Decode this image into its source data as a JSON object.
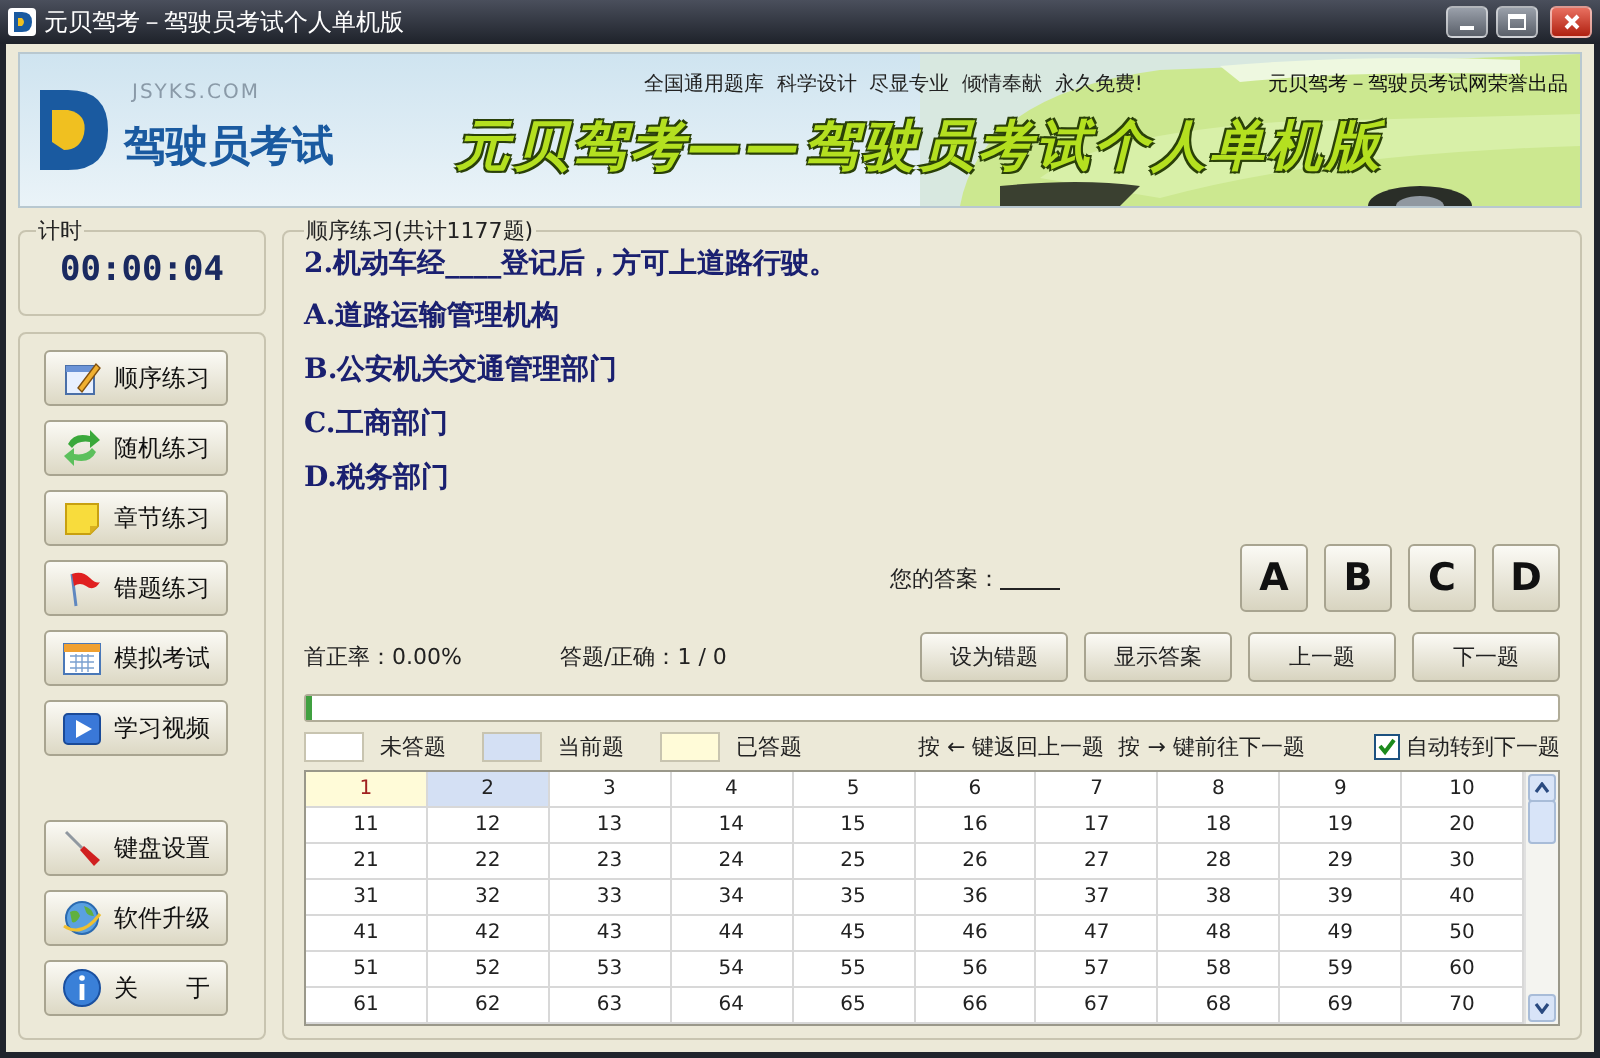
{
  "window": {
    "title": "元贝驾考－驾驶员考试个人单机版"
  },
  "banner": {
    "site": "JSYKS.COM",
    "brand": "驾驶员考试",
    "slogan": "全国通用题库  科学设计  尽显专业  倾情奉献  永久免费!",
    "credit": "元贝驾考－驾驶员考试网荣誉出品",
    "headline": "元贝驾考——驾驶员考试个人单机版"
  },
  "timer": {
    "label": "计时",
    "value": "00:00:04"
  },
  "nav_buttons": [
    "顺序练习",
    "随机练习",
    "章节练习",
    "错题练习",
    "模拟考试",
    "学习视频"
  ],
  "tool_buttons": [
    "键盘设置",
    "软件升级",
    "关　　于"
  ],
  "question": {
    "group_title": "顺序练习(共计1177题)",
    "text": "2.机动车经____登记后，方可上道路行驶。",
    "options": [
      "A.道路运输管理机构",
      "B.公安机关交通管理部门",
      "C.工商部门",
      "D.税务部门"
    ]
  },
  "answer": {
    "label": "您的答案："
  },
  "choice_buttons": [
    "A",
    "B",
    "C",
    "D"
  ],
  "stats": {
    "first_rate": "首正率：0.00%",
    "answered": "答题/正确：1 / 0"
  },
  "action_buttons": [
    "设为错题",
    "显示答案",
    "上一题",
    "下一题"
  ],
  "progress": {
    "level": 0.005
  },
  "legend": [
    {
      "label": "未答题",
      "color": "#ffffff"
    },
    {
      "label": "当前题",
      "color": "#d4e0f4"
    },
    {
      "label": "已答题",
      "color": "#fffbd8"
    }
  ],
  "hint": "按 ← 键返回上一题  按 → 键前往下一题",
  "auto_next": {
    "label": "自动转到下一题",
    "checked": true
  },
  "grid": {
    "cells": [
      {
        "text": "1",
        "color": "#fffbd8",
        "answered": true
      },
      {
        "text": "2",
        "color": "#d4e0f4",
        "answered": false
      },
      {
        "text": "3",
        "color": "#ffffff",
        "answered": false
      },
      {
        "text": "4",
        "color": "#ffffff",
        "answered": false
      },
      {
        "text": "5",
        "color": "#ffffff",
        "answered": false
      },
      {
        "text": "6",
        "color": "#ffffff",
        "answered": false
      },
      {
        "text": "7",
        "color": "#ffffff",
        "answered": false
      },
      {
        "text": "8",
        "color": "#ffffff",
        "answered": false
      },
      {
        "text": "9",
        "color": "#ffffff",
        "answered": false
      },
      {
        "text": "10",
        "color": "#ffffff",
        "answered": false
      },
      {
        "text": "11",
        "color": "#ffffff",
        "answered": false
      },
      {
        "text": "12",
        "color": "#ffffff",
        "answered": false
      },
      {
        "text": "13",
        "color": "#ffffff",
        "answered": false
      },
      {
        "text": "14",
        "color": "#ffffff",
        "answered": false
      },
      {
        "text": "15",
        "color": "#ffffff",
        "answered": false
      },
      {
        "text": "16",
        "color": "#ffffff",
        "answered": false
      },
      {
        "text": "17",
        "color": "#ffffff",
        "answered": false
      },
      {
        "text": "18",
        "color": "#ffffff",
        "answered": false
      },
      {
        "text": "19",
        "color": "#ffffff",
        "answered": false
      },
      {
        "text": "20",
        "color": "#ffffff",
        "answered": false
      },
      {
        "text": "21",
        "color": "#ffffff",
        "answered": false
      },
      {
        "text": "22",
        "color": "#ffffff",
        "answered": false
      },
      {
        "text": "23",
        "color": "#ffffff",
        "answered": false
      },
      {
        "text": "24",
        "color": "#ffffff",
        "answered": false
      },
      {
        "text": "25",
        "color": "#ffffff",
        "answered": false
      },
      {
        "text": "26",
        "color": "#ffffff",
        "answered": false
      },
      {
        "text": "27",
        "color": "#ffffff",
        "answered": false
      },
      {
        "text": "28",
        "color": "#ffffff",
        "answered": false
      },
      {
        "text": "29",
        "color": "#ffffff",
        "answered": false
      },
      {
        "text": "30",
        "color": "#ffffff",
        "answered": false
      },
      {
        "text": "31",
        "color": "#ffffff",
        "answered": false
      },
      {
        "text": "32",
        "color": "#ffffff",
        "answered": false
      },
      {
        "text": "33",
        "color": "#ffffff",
        "answered": false
      },
      {
        "text": "34",
        "color": "#ffffff",
        "answered": false
      },
      {
        "text": "35",
        "color": "#ffffff",
        "answered": false
      },
      {
        "text": "36",
        "color": "#ffffff",
        "answered": false
      },
      {
        "text": "37",
        "color": "#ffffff",
        "answered": false
      },
      {
        "text": "38",
        "color": "#ffffff",
        "answered": false
      },
      {
        "text": "39",
        "color": "#ffffff",
        "answered": false
      },
      {
        "text": "40",
        "color": "#ffffff",
        "answered": false
      },
      {
        "text": "41",
        "color": "#ffffff",
        "answered": false
      },
      {
        "text": "42",
        "color": "#ffffff",
        "answered": false
      },
      {
        "text": "43",
        "color": "#ffffff",
        "answered": false
      },
      {
        "text": "44",
        "color": "#ffffff",
        "answered": false
      },
      {
        "text": "45",
        "color": "#ffffff",
        "answered": false
      },
      {
        "text": "46",
        "color": "#ffffff",
        "answered": false
      },
      {
        "text": "47",
        "color": "#ffffff",
        "answered": false
      },
      {
        "text": "48",
        "color": "#ffffff",
        "answered": false
      },
      {
        "text": "49",
        "color": "#ffffff",
        "answered": false
      },
      {
        "text": "50",
        "color": "#ffffff",
        "answered": false
      },
      {
        "text": "51",
        "color": "#ffffff",
        "answered": false
      },
      {
        "text": "52",
        "color": "#ffffff",
        "answered": false
      },
      {
        "text": "53",
        "color": "#ffffff",
        "answered": false
      },
      {
        "text": "54",
        "color": "#ffffff",
        "answered": false
      },
      {
        "text": "55",
        "color": "#ffffff",
        "answered": false
      },
      {
        "text": "56",
        "color": "#ffffff",
        "answered": false
      },
      {
        "text": "57",
        "color": "#ffffff",
        "answered": false
      },
      {
        "text": "58",
        "color": "#ffffff",
        "answered": false
      },
      {
        "text": "59",
        "color": "#ffffff",
        "answered": false
      },
      {
        "text": "60",
        "color": "#ffffff",
        "answered": false
      },
      {
        "text": "61",
        "color": "#ffffff",
        "answered": false
      },
      {
        "text": "62",
        "color": "#ffffff",
        "answered": false
      },
      {
        "text": "63",
        "color": "#ffffff",
        "answered": false
      },
      {
        "text": "64",
        "color": "#ffffff",
        "answered": false
      },
      {
        "text": "65",
        "color": "#ffffff",
        "answered": false
      },
      {
        "text": "66",
        "color": "#ffffff",
        "answered": false
      },
      {
        "text": "67",
        "color": "#ffffff",
        "answered": false
      },
      {
        "text": "68",
        "color": "#ffffff",
        "answered": false
      },
      {
        "text": "69",
        "color": "#ffffff",
        "answered": false
      },
      {
        "text": "70",
        "color": "#ffffff",
        "answered": false
      }
    ]
  }
}
